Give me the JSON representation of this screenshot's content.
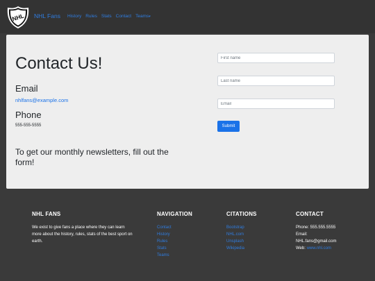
{
  "navbar": {
    "brand": "NHL Fans",
    "links": [
      "History",
      "Rules",
      "Stats",
      "Contact",
      "Teams"
    ]
  },
  "contact": {
    "title": "Contact Us!",
    "email_heading": "Email",
    "email": "nhlfans@example.com",
    "phone_heading": "Phone",
    "phone": "555-555-5555",
    "newsletter": "To get our monthly newsletters, fill out the form!"
  },
  "form": {
    "first_name_placeholder": "First name",
    "last_name_placeholder": "Last name",
    "email_placeholder": "Email",
    "submit_label": "Submit"
  },
  "footer": {
    "about_heading": "NHL FANS",
    "about_text": "We exist to give fans a place where they can learn more about the history, rules, stats of the best sport on earth.",
    "nav_heading": "NAVIGATION",
    "nav_links": [
      "Contact",
      "History",
      "Rules",
      "Stats",
      "Teams"
    ],
    "citations_heading": "CITATIONS",
    "citations": [
      "Bootstrap",
      "NHL.com",
      "Unsplash",
      "Wikipedia"
    ],
    "contact_heading": "CONTACT",
    "contact_phone": "Phone: 555.555.5555",
    "contact_email_label": "Email:",
    "contact_email": "NHL.fans@gmail.com",
    "contact_web_label": "Web:",
    "contact_web": "www.nhl.com"
  },
  "colors": {
    "accent": "#1a72e8",
    "navbar_bg": "#333333",
    "footer_bg": "#3a3a3a",
    "card_bg": "#eeeeee"
  }
}
